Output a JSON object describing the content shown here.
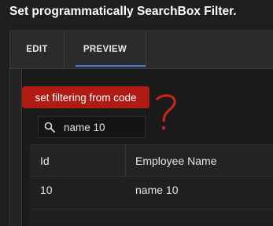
{
  "page": {
    "title": "Set programmatically SearchBox Filter."
  },
  "tabs": [
    {
      "label": "EDIT"
    },
    {
      "label": "PREVIEW",
      "active": true
    }
  ],
  "preview": {
    "filter_button_label": "set filtering from code",
    "annotation_text": "?",
    "search": {
      "value": "name 10",
      "icon": "search-icon"
    },
    "grid": {
      "columns": [
        "Id",
        "Employee Name"
      ],
      "rows": [
        {
          "id": "10",
          "name": "name 10"
        }
      ]
    }
  },
  "colors": {
    "background": "#1e1e1e",
    "button": "#b01c14",
    "annotation": "#d0251b",
    "tab_underline": "#4b7bd4"
  }
}
